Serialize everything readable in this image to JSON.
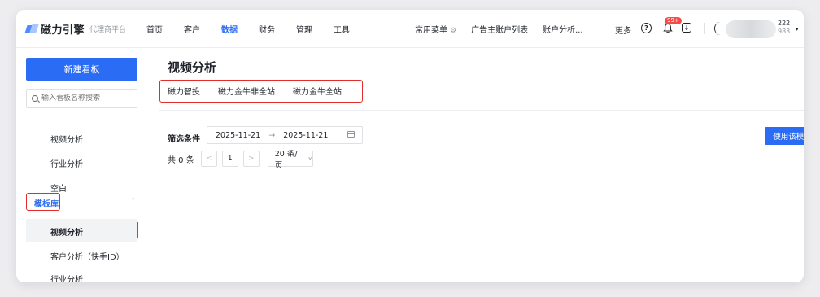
{
  "app": {
    "logo_text": "磁力引擎",
    "logo_sub": "代理商平台"
  },
  "nav": {
    "items": [
      "首页",
      "客户",
      "数据",
      "财务",
      "管理",
      "工具"
    ],
    "active": "数据"
  },
  "right_nav": {
    "common_menu": "常用菜单",
    "ad_accounts": "广告主账户列表",
    "account_analysis": "账户分析...",
    "more": "更多",
    "help_icon": "?",
    "notification_badge": "99+",
    "user_id_top": "222",
    "user_id_bottom": "983"
  },
  "sidebar": {
    "new_board": "新建看板",
    "search_placeholder": "输入看板名称搜索",
    "items": [
      "视频分析",
      "行业分析",
      "空白"
    ],
    "group_label": "模板库",
    "group_items": [
      "视频分析",
      "客户分析（快手ID）",
      "行业分析"
    ],
    "active_item": "视频分析"
  },
  "main": {
    "title": "视频分析",
    "tabs": [
      "磁力智投",
      "磁力金牛非全站",
      "磁力金牛全站"
    ],
    "active_tab": "磁力金牛非全站",
    "filter_label": "筛选条件",
    "date_start": "2025-11-21",
    "date_arrow": "→",
    "date_end": "2025-11-21",
    "use_template": "使用该模板",
    "pagination": {
      "total": "共 0 条",
      "prev": "<",
      "current": "1",
      "next": ">",
      "page_size": "20 条/页"
    }
  },
  "colors": {
    "accent": "#2b6cf5",
    "highlight_border": "#e02e2a",
    "badge": "#f54a45"
  },
  "icons": [
    "search-icon",
    "settings-icon",
    "help-icon",
    "bell-icon",
    "download-icon",
    "calendar-icon",
    "chevron-up-icon",
    "chevron-down-icon"
  ]
}
